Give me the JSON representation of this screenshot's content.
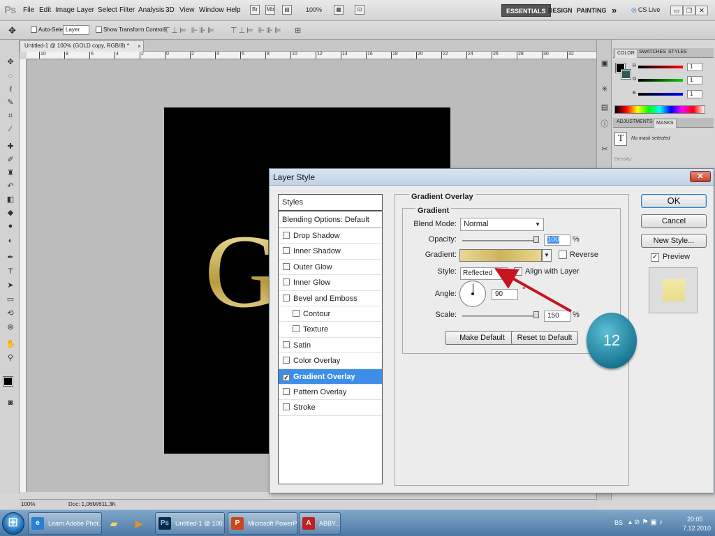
{
  "app": {
    "logo": "Ps",
    "menu": [
      "File",
      "Edit",
      "Image",
      "Layer",
      "Select",
      "Filter",
      "Analysis",
      "3D",
      "View",
      "Window",
      "Help"
    ],
    "zoom": "100%",
    "workspaces": [
      "ESSENTIALS",
      "DESIGN",
      "PAINTING"
    ],
    "more": "»",
    "cs_live": "CS Live"
  },
  "options_bar": {
    "auto_select_label": "Auto-Select:",
    "auto_select_value": "Layer",
    "transform_label": "Show Transform Controls"
  },
  "document": {
    "tab_title": "Untitled-1 @ 100% (GOLD copy, RGB/8) *",
    "tab_close": "×",
    "canvas_text": "GOLD",
    "status_zoom": "100%",
    "status_doc": "Doc: 1,06M/611,3K",
    "ruler_labels": [
      "10",
      "8",
      "6",
      "4",
      "2",
      "0",
      "2",
      "4",
      "6",
      "8",
      "10",
      "12",
      "14",
      "16",
      "18",
      "20",
      "22",
      "24",
      "26",
      "28",
      "30",
      "32"
    ]
  },
  "panels": {
    "color_tabs": [
      "COLOR",
      "SWATCHES",
      "STYLES"
    ],
    "channels": [
      {
        "letter": "R",
        "value": "1"
      },
      {
        "letter": "G",
        "value": "1"
      },
      {
        "letter": "B",
        "value": "1"
      }
    ],
    "mask_tabs": [
      "ADJUSTMENTS",
      "MASKS"
    ],
    "no_mask": "No mask selected",
    "density": "Density:"
  },
  "dialog": {
    "title": "Layer Style",
    "close": "✕",
    "styles_header": "Styles",
    "blending_options": "Blending Options: Default",
    "style_items": [
      {
        "label": "Drop Shadow",
        "checked": false,
        "indent": false,
        "active": false
      },
      {
        "label": "Inner Shadow",
        "checked": false,
        "indent": false,
        "active": false
      },
      {
        "label": "Outer Glow",
        "checked": false,
        "indent": false,
        "active": false
      },
      {
        "label": "Inner Glow",
        "checked": false,
        "indent": false,
        "active": false
      },
      {
        "label": "Bevel and Emboss",
        "checked": false,
        "indent": false,
        "active": false
      },
      {
        "label": "Contour",
        "checked": false,
        "indent": true,
        "active": false
      },
      {
        "label": "Texture",
        "checked": false,
        "indent": true,
        "active": false
      },
      {
        "label": "Satin",
        "checked": false,
        "indent": false,
        "active": false
      },
      {
        "label": "Color Overlay",
        "checked": false,
        "indent": false,
        "active": false
      },
      {
        "label": "Gradient Overlay",
        "checked": true,
        "indent": false,
        "active": true
      },
      {
        "label": "Pattern Overlay",
        "checked": false,
        "indent": false,
        "active": false
      },
      {
        "label": "Stroke",
        "checked": false,
        "indent": false,
        "active": false
      }
    ],
    "section_title": "Gradient Overlay",
    "subsection_title": "Gradient",
    "blend_mode_label": "Blend Mode:",
    "blend_mode_value": "Normal",
    "opacity_label": "Opacity:",
    "opacity_value": "100",
    "opacity_unit": "%",
    "gradient_label": "Gradient:",
    "reverse_label": "Reverse",
    "reverse_checked": false,
    "style_label": "Style:",
    "style_value": "Reflected",
    "align_label": "Align with Layer",
    "align_checked": true,
    "angle_label": "Angle:",
    "angle_value": "90",
    "angle_unit": "°",
    "scale_label": "Scale:",
    "scale_value": "150",
    "scale_unit": "%",
    "make_default": "Make Default",
    "reset_default": "Reset to Default",
    "ok": "OK",
    "cancel": "Cancel",
    "new_style": "New Style...",
    "preview_label": "Preview",
    "preview_checked": true
  },
  "annotation": {
    "step": "12"
  },
  "taskbar": {
    "tasks": [
      {
        "label": "Learn Adobe Phot...",
        "icon": "e",
        "color": "#2a7fd4"
      },
      {
        "label": "Untitled-1 @ 100...",
        "icon": "Ps",
        "color": "#0b2a4a"
      },
      {
        "label": "Microsoft PowerP...",
        "icon": "P",
        "color": "#c8481e"
      },
      {
        "label": "ABBY...",
        "icon": "A",
        "color": "#c0201f"
      }
    ],
    "lang": "BS",
    "time": "20:05",
    "date": "7.12.2010"
  }
}
